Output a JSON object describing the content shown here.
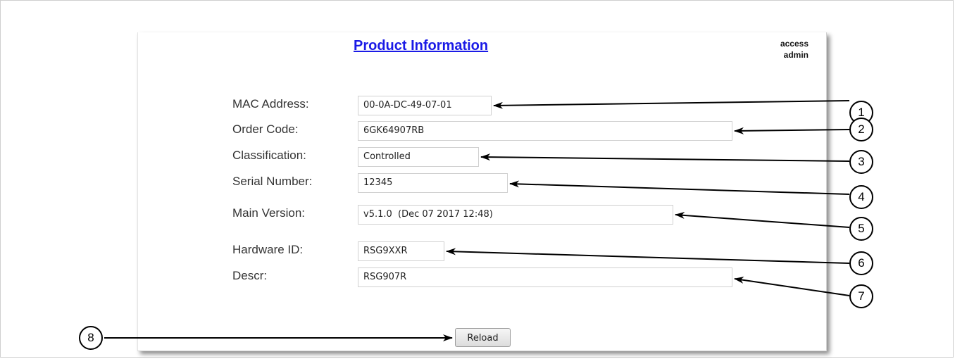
{
  "page": {
    "title": "Product Information",
    "access_label": "access",
    "access_level": "admin"
  },
  "fields": {
    "mac": {
      "label": "MAC Address:",
      "value": "00-0A-DC-49-07-01"
    },
    "order_code": {
      "label": "Order Code:",
      "value": "6GK64907RB"
    },
    "classification": {
      "label": "Classification:",
      "value": "Controlled"
    },
    "serial": {
      "label": "Serial Number:",
      "value": "12345"
    },
    "main_version": {
      "label": "Main Version:",
      "value": "v5.1.0  (Dec 07 2017 12:48)"
    },
    "hardware_id": {
      "label": "Hardware ID:",
      "value": "RSG9XXR"
    },
    "descr": {
      "label": "Descr:",
      "value": "RSG907R"
    }
  },
  "actions": {
    "reload_label": "Reload"
  },
  "callouts": [
    "1",
    "2",
    "3",
    "4",
    "5",
    "6",
    "7",
    "8"
  ],
  "colors": {
    "title_link": "#1a1ae6",
    "callout_stroke": "#000000"
  }
}
